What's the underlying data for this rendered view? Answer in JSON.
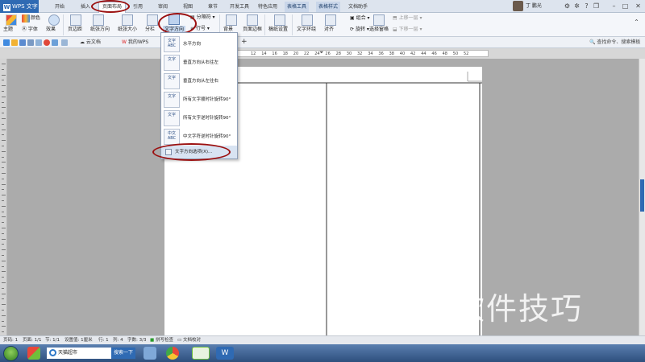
{
  "app": {
    "title": "WPS 文字"
  },
  "menu_tabs": [
    "开始",
    "插入",
    "页面布局",
    "引用",
    "审阅",
    "视图",
    "章节",
    "开发工具",
    "特色应用",
    "表格工具",
    "表格样式",
    "文档助手"
  ],
  "user": {
    "name": "丁 鹏光"
  },
  "ribbon": {
    "theme": "主题",
    "colors": "颜色",
    "fonts": "字体",
    "effects": "效果",
    "margins": "页边距",
    "orientation": "纸张方向",
    "size": "纸张大小",
    "columns": "分栏",
    "text_direction": "文字方向",
    "breaks": "分隔符",
    "line_numbers": "行号",
    "background": "背景",
    "page_border": "页面边框",
    "draft_settings": "稿纸设置",
    "text_wrap": "文字环绕",
    "align": "对齐",
    "rotate": "旋转",
    "group": "组合",
    "selection_pane": "选择窗格",
    "bring_forward": "上移一层",
    "send_backward": "下移一层"
  },
  "doc_tabs": [
    "云文档",
    "我的WPS"
  ],
  "search": {
    "placeholder": "查找命令、搜索模板"
  },
  "ruler_numbers": [
    "12",
    "14",
    "16",
    "18",
    "20",
    "22",
    "24",
    "26",
    "28",
    "30",
    "32",
    "34",
    "36",
    "38",
    "40",
    "42",
    "44",
    "46",
    "48",
    "50",
    "52"
  ],
  "text_direction_menu": {
    "items": [
      {
        "icon_text": "文字ABC",
        "label": "水平方向"
      },
      {
        "icon_text": "文字",
        "label": "垂直方向从右往左"
      },
      {
        "icon_text": "文字",
        "label": "垂直方向从左往右"
      },
      {
        "icon_text": "文字",
        "label": "所有文字顺时针旋转90°"
      },
      {
        "icon_text": "文字",
        "label": "所有文字逆时针旋转90°"
      },
      {
        "icon_text": "中文ABC",
        "label": "中文字符逆时针旋转90°"
      }
    ],
    "options_label": "文字方向选项(X)..."
  },
  "status": {
    "page_num": "页码: 1",
    "pages": "页面: 1/1",
    "section": "节: 1/1",
    "position": "设置值: 1厘米",
    "line": "行: 1",
    "column": "列: 4",
    "word_count": "字数: 3/3",
    "spell_check": "拼写检查",
    "doc_proof": "文档校对"
  },
  "taskbar": {
    "address": "天猫超市",
    "go_button": "搜索一下"
  },
  "watermark": "软件技巧",
  "colors": {
    "accent": "#2f6ab3",
    "annotation": "#9b1010",
    "context_tab": "#c9d6e9"
  }
}
